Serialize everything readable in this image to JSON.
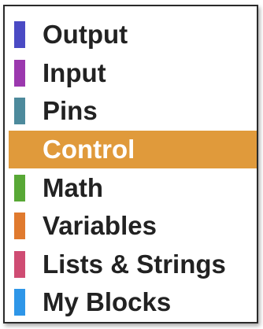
{
  "categories": [
    {
      "label": "Output",
      "color": "#4a4ac4",
      "selected": false,
      "icon": "category-swatch"
    },
    {
      "label": "Input",
      "color": "#9b38ae",
      "selected": false,
      "icon": "category-swatch"
    },
    {
      "label": "Pins",
      "color": "#4d8a9c",
      "selected": false,
      "icon": "category-swatch"
    },
    {
      "label": "Control",
      "color": "#e09a3b",
      "selected": true,
      "icon": "category-swatch"
    },
    {
      "label": "Math",
      "color": "#58a836",
      "selected": false,
      "icon": "category-swatch"
    },
    {
      "label": "Variables",
      "color": "#e07a2e",
      "selected": false,
      "icon": "category-swatch"
    },
    {
      "label": "Lists & Strings",
      "color": "#cf4c73",
      "selected": false,
      "icon": "category-swatch"
    },
    {
      "label": "My Blocks",
      "color": "#2e96e8",
      "selected": false,
      "icon": "category-swatch"
    }
  ]
}
